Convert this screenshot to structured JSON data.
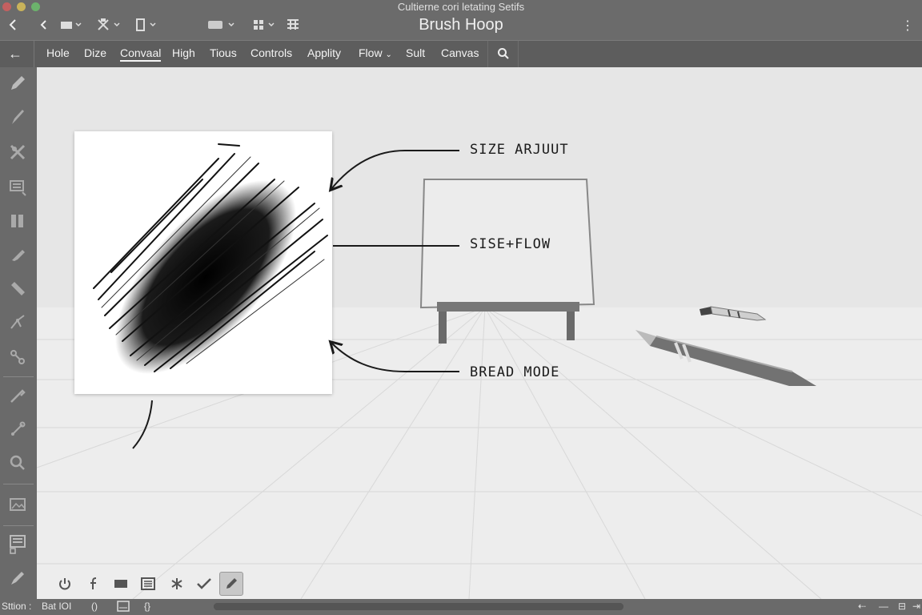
{
  "window": {
    "title": "Cultierne cori letating Setifs",
    "app_title": "Brush Hoop"
  },
  "menu": {
    "items": [
      "Hole",
      "Dize",
      "Convaal",
      "High",
      "Tious",
      "Controls",
      "Applity",
      "Flow",
      "Sult",
      "Canvas"
    ],
    "active": "Convaal"
  },
  "annotations": {
    "size_adjust": "SIZE ARJUUT",
    "size_flow": "SISE+FLOW",
    "blend_mode": "BREAD MODE"
  },
  "statusbar": {
    "section": "Sttion :",
    "value": "Bat IOI",
    "brace": "()",
    "right_icons": [
      "arrow-left-icon",
      "minus-icon",
      "layers-icon",
      "expand-icon"
    ]
  },
  "left_tools": [
    "pencil-icon",
    "brush-icon",
    "crossed-tools-icon",
    "layers-icon",
    "columns-icon",
    "marker-icon",
    "eraser-icon",
    "transform-icon",
    "node-icon",
    "eyedropper-icon",
    "pen-nib-icon",
    "zoom-icon",
    "image-icon",
    "settings-list-icon",
    "paint-icon"
  ],
  "bottom_tools": [
    "power-icon",
    "function-icon",
    "rectangle-icon",
    "list-icon",
    "asterisk-icon",
    "check-icon",
    "pencil-icon"
  ],
  "colors": {
    "chrome": "#6b6b6b",
    "menubar": "#5d5d5d",
    "canvas": "#e8e8e8",
    "ink": "#1a1a1a"
  }
}
